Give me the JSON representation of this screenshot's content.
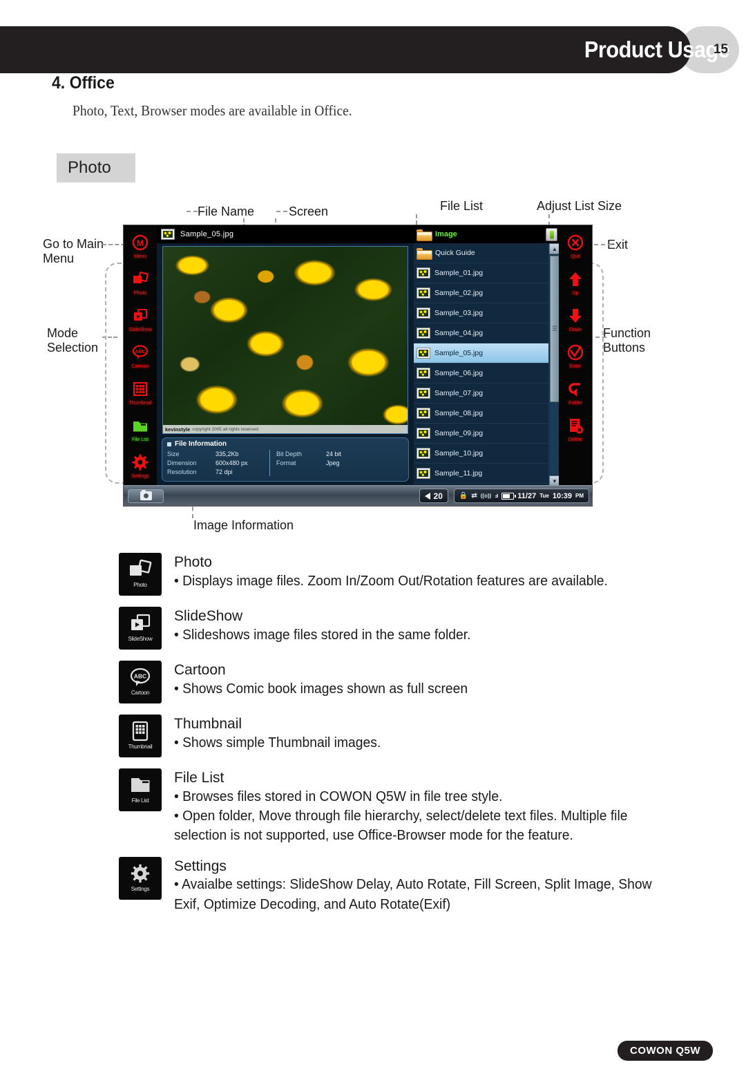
{
  "header": {
    "title": "Product Usage",
    "page_number": "15"
  },
  "section": {
    "number_title": "4. Office",
    "subtitle": "Photo, Text, Browser modes are available in Office.",
    "tag": "Photo"
  },
  "callouts": {
    "go_to_main_menu": "Go to Main\nMenu",
    "mode_selection": "Mode\nSelection",
    "file_name": "File Name",
    "screen": "Screen",
    "file_list": "File List",
    "adjust_list_size": "Adjust List Size",
    "exit": "Exit",
    "function_buttons": "Function\nButtons",
    "image_information": "Image Information"
  },
  "device": {
    "title_bar": {
      "file_name": "Sample_05.jpg",
      "icon": "image-thumbnail-icon"
    },
    "mode_buttons": [
      {
        "label": "Menu",
        "icon": "menu-circle-m-icon",
        "active": false
      },
      {
        "label": "Photo",
        "icon": "photo-icon",
        "active": false
      },
      {
        "label": "SlideShow",
        "icon": "slideshow-icon",
        "active": false
      },
      {
        "label": "Cartoon",
        "icon": "cartoon-abc-icon",
        "active": false
      },
      {
        "label": "Thumbnail",
        "icon": "thumbnail-grid-icon",
        "active": false
      },
      {
        "label": "File List",
        "icon": "file-list-folder-icon",
        "active": true
      },
      {
        "label": "Settings",
        "icon": "settings-gear-icon",
        "active": false
      }
    ],
    "function_buttons": [
      {
        "label": "Quit",
        "icon": "quit-x-circle-icon"
      },
      {
        "label": "Up",
        "icon": "arrow-up-icon"
      },
      {
        "label": "Down",
        "icon": "arrow-down-icon"
      },
      {
        "label": "Enter",
        "icon": "enter-check-circle-icon"
      },
      {
        "label": "Folder",
        "icon": "folder-back-arrow-icon"
      },
      {
        "label": "Delete",
        "icon": "delete-document-x-icon"
      }
    ],
    "watermark": {
      "brand": "kevinstyle",
      "text": "copyright 2005 all rights reserved"
    },
    "file_information": {
      "heading": "File Information",
      "fields": [
        {
          "key": "Size",
          "value": "335,2Kb"
        },
        {
          "key": "Dimension",
          "value": "600x480 px"
        },
        {
          "key": "Resolution",
          "value": "72 dpi"
        },
        {
          "key": "Bit Depth",
          "value": "24 bit"
        },
        {
          "key": "Format",
          "value": "Jpeg"
        }
      ]
    },
    "file_list": {
      "folder_title": "Image",
      "adjust_button_icon": "adjust-list-size-icon",
      "items": [
        {
          "name": "Quick Guide",
          "type": "folder",
          "selected": false
        },
        {
          "name": "Sample_01.jpg",
          "type": "image",
          "selected": false
        },
        {
          "name": "Sample_02.jpg",
          "type": "image",
          "selected": false
        },
        {
          "name": "Sample_03.jpg",
          "type": "image",
          "selected": false
        },
        {
          "name": "Sample_04.jpg",
          "type": "image",
          "selected": false
        },
        {
          "name": "Sample_05.jpg",
          "type": "image",
          "selected": true
        },
        {
          "name": "Sample_06.jpg",
          "type": "image",
          "selected": false
        },
        {
          "name": "Sample_07.jpg",
          "type": "image",
          "selected": false
        },
        {
          "name": "Sample_08.jpg",
          "type": "image",
          "selected": false
        },
        {
          "name": "Sample_09.jpg",
          "type": "image",
          "selected": false
        },
        {
          "name": "Sample_10.jpg",
          "type": "image",
          "selected": false
        },
        {
          "name": "Sample_11.jpg",
          "type": "image",
          "selected": false
        }
      ]
    },
    "status_bar": {
      "camera_icon": "camera-icon",
      "volume": "20",
      "lock_icon": "lock-icon",
      "usb_icon": "usb-icon",
      "wifi_icon": "wireless-icon",
      "bluetooth_icon": "bluetooth-icon",
      "battery_icon": "battery-icon",
      "date": "11/27",
      "weekday": "Tue",
      "time": "10:39",
      "meridiem": "PM"
    }
  },
  "legend": [
    {
      "icon": "photo-icon",
      "caption": "Photo",
      "title": "Photo",
      "lines": [
        "• Displays image files. Zoom In/Zoom Out/Rotation features are available."
      ]
    },
    {
      "icon": "slideshow-icon",
      "caption": "SlideShow",
      "title": "SlideShow",
      "lines": [
        "• Slideshows image files stored in the same folder."
      ]
    },
    {
      "icon": "cartoon-abc-icon",
      "caption": "Cartoon",
      "title": "Cartoon",
      "lines": [
        "• Shows Comic book images shown as full screen"
      ]
    },
    {
      "icon": "thumbnail-grid-icon",
      "caption": "Thumbnail",
      "title": "Thumbnail",
      "lines": [
        "• Shows simple Thumbnail images."
      ]
    },
    {
      "icon": "file-list-folder-icon",
      "caption": "File List",
      "title": "File List",
      "lines": [
        "• Browses files stored in COWON Q5W in file tree style.",
        "• Open folder, Move through file hierarchy, select/delete text files.  Multiple file selection is not supported, use Office-Browser mode for the feature."
      ]
    },
    {
      "icon": "settings-gear-icon",
      "caption": "Settings",
      "title": "Settings",
      "lines": [
        "• Avaialbe settings: SlideShow Delay, Auto Rotate, Fill Screen, Split Image, Show Exif, Optimize Decoding, and Auto Rotate(Exif)"
      ]
    }
  ],
  "footer": {
    "product": "COWON Q5W"
  },
  "colors": {
    "header_bar": "#231f20",
    "page_pill": "#d4d4d4",
    "tag_bg": "#d4d4d4",
    "device_red": "#ee1111",
    "device_active_green": "#55dd22",
    "list_selected": "#8cc3e8"
  }
}
